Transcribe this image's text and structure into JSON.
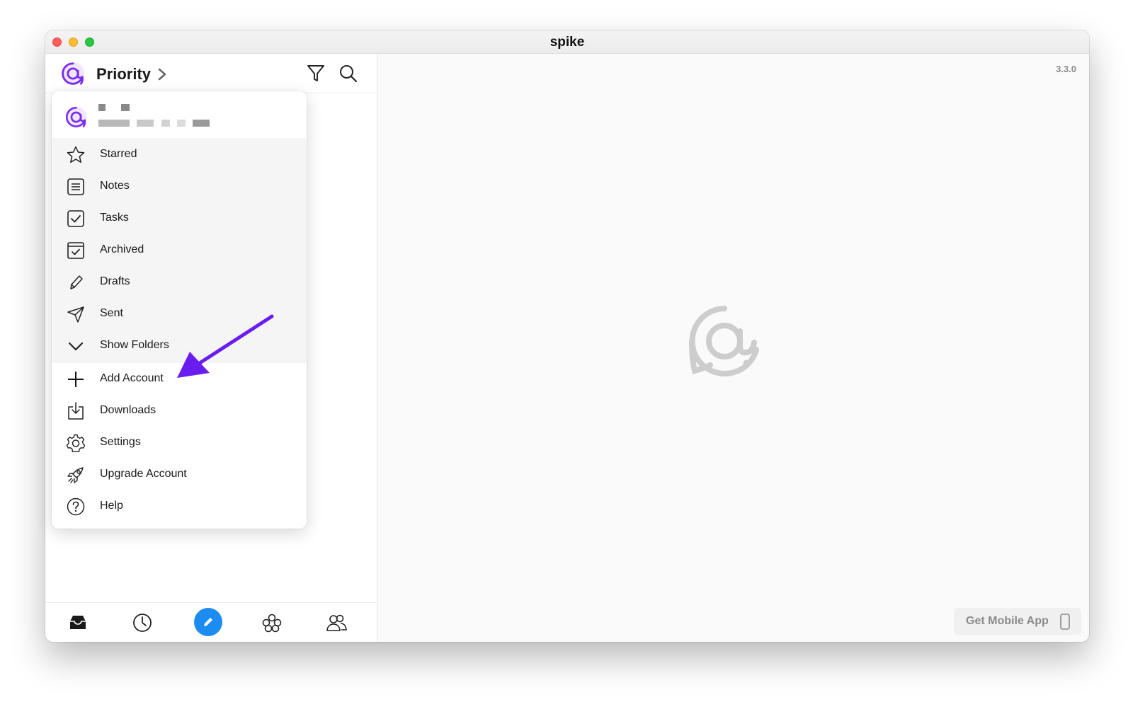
{
  "window": {
    "title": "spike"
  },
  "sidebar": {
    "header_title": "Priority"
  },
  "dropdown": {
    "items": [
      {
        "label": "Starred",
        "icon": "star-icon"
      },
      {
        "label": "Notes",
        "icon": "notes-icon"
      },
      {
        "label": "Tasks",
        "icon": "tasks-checkbox-icon"
      },
      {
        "label": "Archived",
        "icon": "archive-icon"
      },
      {
        "label": "Drafts",
        "icon": "pencil-icon"
      },
      {
        "label": "Sent",
        "icon": "paper-plane-icon"
      },
      {
        "label": "Show Folders",
        "icon": "chevron-down-icon"
      },
      {
        "label": "Add Account",
        "icon": "plus-icon"
      },
      {
        "label": "Downloads",
        "icon": "download-icon"
      },
      {
        "label": "Settings",
        "icon": "gear-icon"
      },
      {
        "label": "Upgrade Account",
        "icon": "rocket-icon"
      },
      {
        "label": "Help",
        "icon": "help-circle-icon"
      }
    ]
  },
  "bottom_nav": [
    "inbox-tray-icon",
    "clock-icon",
    "compose-pencil-icon",
    "groups-icon",
    "contacts-icon"
  ],
  "main": {
    "version": "3.3.0",
    "mobile_button": "Get Mobile App"
  },
  "colors": {
    "brand_purple": "#7a2cf0",
    "compose_blue": "#1d8cf0",
    "annotation_arrow": "#6a1df0"
  }
}
